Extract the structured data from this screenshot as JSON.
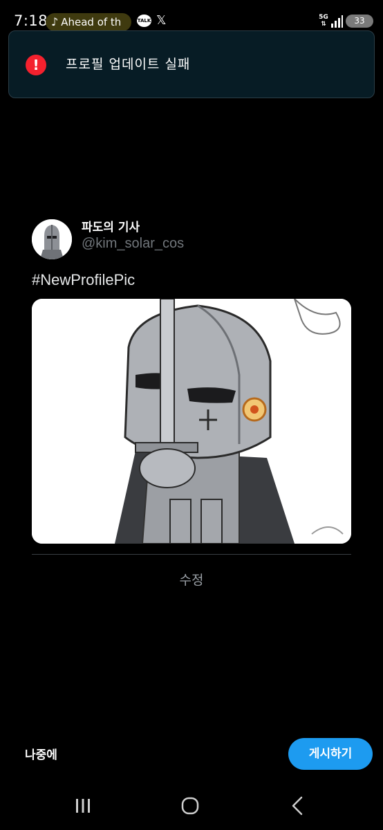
{
  "status_bar": {
    "time": "7:18",
    "media_title": "Ahead of th",
    "talk_label": "TALK",
    "x_label": "𝕏",
    "network": "5G",
    "battery": "33"
  },
  "toast": {
    "message": "프로필 업데이트 실패",
    "icon": "error-icon",
    "icon_glyph": "!",
    "color": "#f4212e"
  },
  "post": {
    "display_name": "파도의 기사",
    "handle": "@kim_solar_cos",
    "text": "#NewProfilePic",
    "edit_label": "수정"
  },
  "actions": {
    "later_label": "나중에",
    "post_label": "게시하기",
    "accent": "#1d9bf0"
  },
  "nav": {
    "recent": "recent-apps-icon",
    "home": "home-icon",
    "back": "back-icon"
  }
}
